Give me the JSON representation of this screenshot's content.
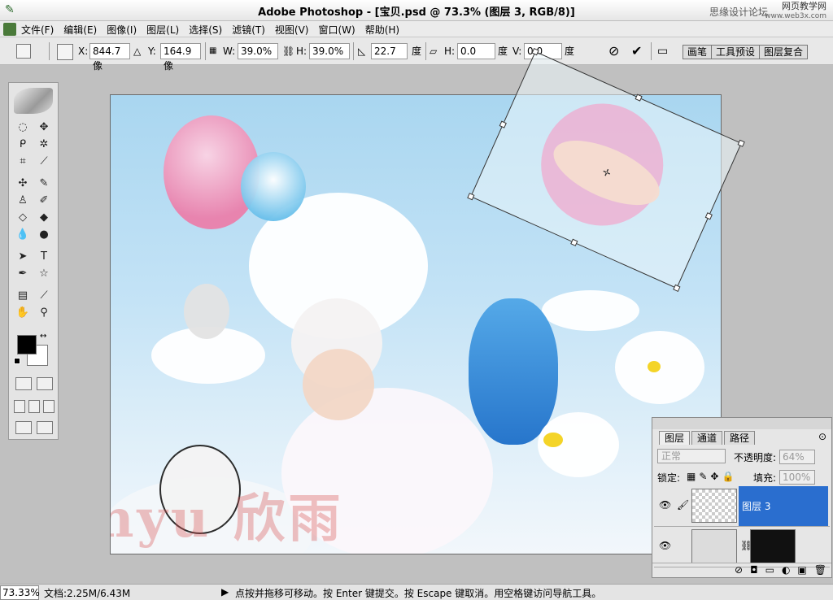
{
  "titlebar": {
    "title": "Adobe Photoshop - [宝贝.psd @ 73.3% (图层 3, RGB/8)]",
    "watermark_left": "思缘设计论坛",
    "watermark_right": "网页教学网",
    "watermark_url": "www.web3x.com"
  },
  "menu": [
    "文件(F)",
    "编辑(E)",
    "图像(I)",
    "图层(L)",
    "选择(S)",
    "滤镜(T)",
    "视图(V)",
    "窗口(W)",
    "帮助(H)"
  ],
  "options": {
    "x_label": "X:",
    "x_value": "844.7 像",
    "y_label": "Y:",
    "y_value": "164.9 像",
    "w_label": "W:",
    "w_value": "39.0%",
    "h_label": "H:",
    "h_value": "39.0%",
    "angle_value": "22.7",
    "angle_unit": "度",
    "hskew_label": "H:",
    "hskew_value": "0.0",
    "hskew_unit": "度",
    "vskew_label": "V:",
    "vskew_value": "0.0",
    "vskew_unit": "度",
    "palette_tabs": [
      "画笔",
      "工具预设",
      "图层复合"
    ]
  },
  "layers": {
    "tabs": [
      "图层",
      "通道",
      "路径"
    ],
    "blend_mode": "正常",
    "opacity_label": "不透明度:",
    "opacity_value": "64%",
    "lock_label": "锁定:",
    "fill_label": "填充:",
    "fill_value": "100%",
    "items": [
      {
        "name": "图层 3",
        "selected": true,
        "visible": true
      },
      {
        "name": "",
        "selected": false,
        "visible": true
      }
    ]
  },
  "statusbar": {
    "zoom": "73.33%",
    "doc": "文档:2.25M/6.43M",
    "hint": "点按并拖移可移动。按 Enter 键提交。按 Escape 键取消。用空格键访问导航工具。"
  },
  "canvas": {
    "watermark": "Xinyu 欣雨"
  },
  "colors": {
    "foreground": "#000000",
    "background": "#ffffff",
    "selected_layer": "#2a6ecf"
  }
}
